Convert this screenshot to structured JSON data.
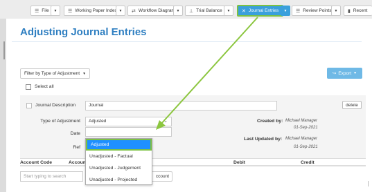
{
  "toolbar": {
    "file": "File",
    "wp_index": "Working Paper Index",
    "workflow": "Workflow Diagram",
    "trial_balance": "Trial Balance",
    "journal_entries": "Journal Entries",
    "review_points": "Review Points",
    "recent": "Recent",
    "caret": "▼"
  },
  "page": {
    "title": "Adjusting Journal Entries"
  },
  "filter": {
    "label": "Filter by Type of Adjustment",
    "caret": "▼"
  },
  "export": {
    "label": "Export",
    "caret": "▼"
  },
  "select_all": "Select all",
  "entry": {
    "desc_label": "Journal Description",
    "desc_value": "Journal",
    "delete": "delete",
    "type_label": "Type of Adjustment",
    "type_value": "Adjusted",
    "date_label": "Date",
    "ref_label": "Ref",
    "created_label": "Created by:",
    "created_by": "Michael Manager",
    "created_date": "01-Sep-2021",
    "updated_label": "Last Updated by:",
    "updated_by": "Michael Manager",
    "updated_date": "01-Sep-2021"
  },
  "dropdown": {
    "options": [
      "Adjusted",
      "Unadjusted - Factual",
      "Unadjusted - Judgement",
      "Unadjusted - Projected"
    ]
  },
  "table": {
    "headers": [
      "Account Code",
      "Accoun",
      "Debit",
      "Credit"
    ]
  },
  "search": {
    "placeholder": "Start typing to search"
  },
  "add_account": "ccount",
  "colors": {
    "accent": "#2f7fc1",
    "active_tab": "#3aa0dc",
    "highlight": "#7cc143"
  }
}
